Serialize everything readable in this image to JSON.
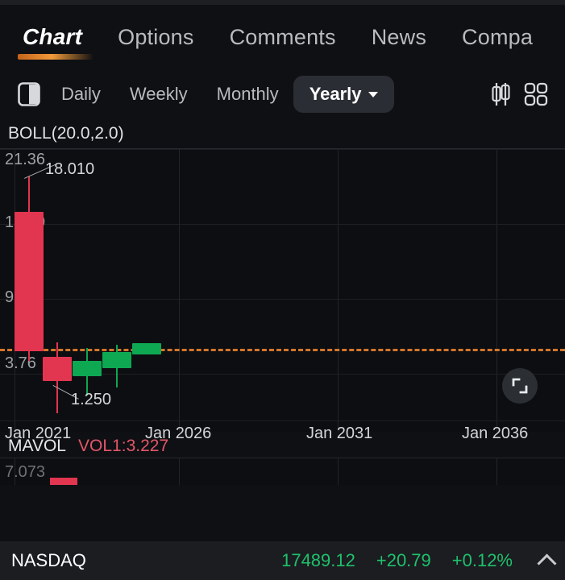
{
  "theme": {
    "bg": "#0f1013",
    "panel_bg": "#0d0e11",
    "up_color": "#0EA852",
    "down_color": "#E23550",
    "dash_color": "#d3762a",
    "accent": "#f09a3a",
    "ticker_up": "#1fc16b"
  },
  "tabs": [
    {
      "label": "Chart",
      "active": true
    },
    {
      "label": "Options",
      "active": false
    },
    {
      "label": "Comments",
      "active": false
    },
    {
      "label": "News",
      "active": false
    },
    {
      "label": "Compa",
      "active": false
    }
  ],
  "toolbar": {
    "layout_icon": "split-pane-icon",
    "timeframes": [
      {
        "label": "Daily",
        "selected": false
      },
      {
        "label": "Weekly",
        "selected": false
      },
      {
        "label": "Monthly",
        "selected": false
      },
      {
        "label": "Yearly",
        "selected": true
      }
    ],
    "chart_type_icon": "candlestick-icon",
    "more_icon": "grid-apps-icon"
  },
  "chart_panel": {
    "indicator_label": "BOLL(20.0,2.0)",
    "expand_button_icon": "fullscreen-icon",
    "annotations": [
      {
        "text": "18.010",
        "kind": "high"
      },
      {
        "text": "1.250",
        "kind": "low"
      }
    ]
  },
  "volume_panel": {
    "title": "MAVOL",
    "value_label": "VOL1:3.227",
    "y_label": "7.073"
  },
  "ticker": {
    "name": "NASDAQ",
    "price": "17489.12",
    "change": "+20.79",
    "change_pct": "+0.12%",
    "direction_icon": "chevron-up-icon"
  },
  "chart_data": {
    "type": "candlestick",
    "title": "BOLL(20.0,2.0)",
    "xlabel": "",
    "ylabel": "",
    "ylim": [
      1.25,
      21.36
    ],
    "y_ticks": [
      "21.36",
      "15.50",
      "9.63",
      "3.76"
    ],
    "x_ticks": [
      "Jan 2021",
      "Jan 2026",
      "Jan 2031",
      "Jan 2036"
    ],
    "grid": true,
    "legend": "none",
    "reference_line": {
      "value": 4.55,
      "style": "dashed",
      "color": "#d3762a"
    },
    "high_annotation": 18.01,
    "low_annotation": 1.25,
    "candles": [
      {
        "x": "2021",
        "open": 16.2,
        "high": 18.01,
        "low": 4.3,
        "close": 4.6,
        "dir": "down"
      },
      {
        "x": "2022",
        "open": 4.55,
        "high": 4.8,
        "low": 1.25,
        "close": 3.3,
        "dir": "down"
      },
      {
        "x": "2023",
        "open": 3.1,
        "high": 4.6,
        "low": 2.1,
        "close": 3.6,
        "dir": "up"
      },
      {
        "x": "2024",
        "open": 3.5,
        "high": 4.7,
        "low": 2.6,
        "close": 4.2,
        "dir": "up"
      },
      {
        "x": "2025",
        "open": 4.3,
        "high": 4.9,
        "low": 4.2,
        "close": 4.8,
        "dir": "up"
      }
    ],
    "volume_bars": [
      {
        "x": "2021",
        "value": 7.073,
        "dir": "down"
      }
    ]
  }
}
